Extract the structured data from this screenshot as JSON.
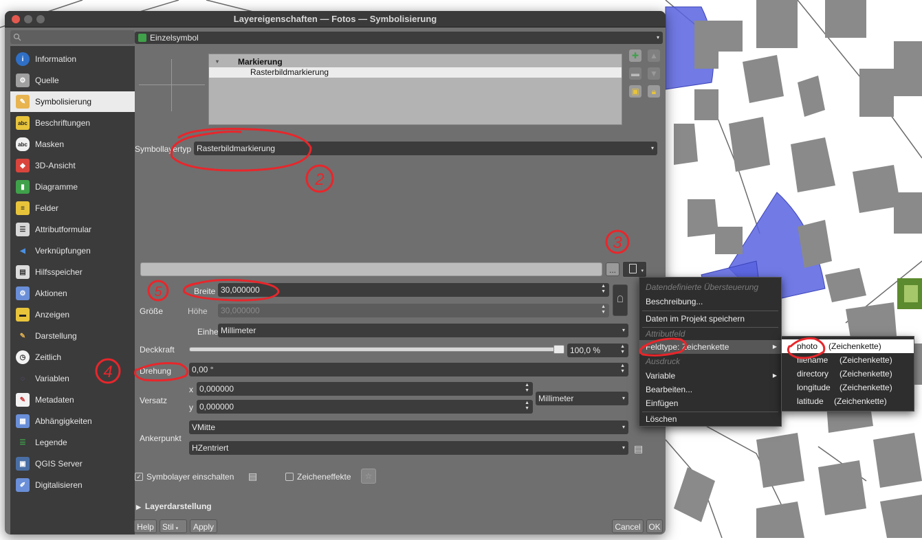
{
  "window": {
    "title": "Layereigenschaften — Fotos — Symbolisierung"
  },
  "search": {
    "placeholder": ""
  },
  "sidebar": {
    "items": [
      {
        "label": "Information",
        "icon": "info-icon",
        "active": false
      },
      {
        "label": "Quelle",
        "icon": "source-icon",
        "active": false
      },
      {
        "label": "Symbolisierung",
        "icon": "paintbrush-icon",
        "active": true
      },
      {
        "label": "Beschriftungen",
        "icon": "labels-abc-icon",
        "active": false
      },
      {
        "label": "Masken",
        "icon": "masks-abc-icon",
        "active": false
      },
      {
        "label": "3D-Ansicht",
        "icon": "cube-3d-icon",
        "active": false
      },
      {
        "label": "Diagramme",
        "icon": "diagram-icon",
        "active": false
      },
      {
        "label": "Felder",
        "icon": "fields-icon",
        "active": false
      },
      {
        "label": "Attributformular",
        "icon": "form-icon",
        "active": false
      },
      {
        "label": "Verknüpfungen",
        "icon": "join-icon",
        "active": false
      },
      {
        "label": "Hilfsspeicher",
        "icon": "storage-icon",
        "active": false
      },
      {
        "label": "Aktionen",
        "icon": "gear-icon",
        "active": false
      },
      {
        "label": "Anzeigen",
        "icon": "speech-bubble-icon",
        "active": false
      },
      {
        "label": "Darstellung",
        "icon": "brush-icon",
        "active": false
      },
      {
        "label": "Zeitlich",
        "icon": "clock-icon",
        "active": false
      },
      {
        "label": "Variablen",
        "icon": "variables-icon",
        "active": false
      },
      {
        "label": "Metadaten",
        "icon": "metadata-icon",
        "active": false
      },
      {
        "label": "Abhängigkeiten",
        "icon": "dependencies-icon",
        "active": false
      },
      {
        "label": "Legende",
        "icon": "legend-icon",
        "active": false
      },
      {
        "label": "QGIS Server",
        "icon": "server-icon",
        "active": false
      },
      {
        "label": "Digitalisieren",
        "icon": "digitize-icon",
        "active": false
      }
    ]
  },
  "renderer": {
    "type": "Einzelsymbol"
  },
  "layer_tree": {
    "parent": "Markierung",
    "child": "Rasterbildmarkierung"
  },
  "symbol_layer_type": {
    "label": "Symbollayertyp",
    "value": "Rasterbildmarkierung"
  },
  "file": {
    "path": "",
    "browse_label": "..."
  },
  "size": {
    "group_label": "Größe",
    "width_label": "Breite",
    "width_value": "30,000000",
    "height_label": "Höhe",
    "height_value": "30,000000",
    "unit_label": "Einheit",
    "unit_value": "Millimeter"
  },
  "opacity": {
    "label": "Deckkraft",
    "value": "100,0 %",
    "level": 1.0
  },
  "rotation": {
    "label": "Drehung",
    "value": "0,00 °"
  },
  "offset": {
    "label": "Versatz",
    "x_label": "x",
    "x_value": "0,000000",
    "y_label": "y",
    "y_value": "0,000000",
    "unit_value": "Millimeter"
  },
  "anchor": {
    "label": "Ankerpunkt",
    "vertical": "VMitte",
    "horizontal": "HZentriert"
  },
  "options": {
    "enable_label": "Symbolayer einschalten",
    "enabled": true,
    "effects_label": "Zeicheneffekte",
    "effects": false
  },
  "layer_render": {
    "label": "Layerdarstellung"
  },
  "footer": {
    "help": "Help",
    "style": "Stil",
    "apply": "Apply",
    "cancel": "Cancel",
    "ok": "OK"
  },
  "context_menu": {
    "header": "Datendefinierte Übersteuerung",
    "description": "Beschreibung...",
    "store": "Daten im Projekt speichern",
    "attribute_field": "Attributfeld",
    "field_type": "Feldtype: Zeichenkette",
    "expression": "Ausdruck",
    "variable": "Variable",
    "edit": "Bearbeiten...",
    "paste": "Einfügen",
    "delete": "Löschen"
  },
  "field_submenu": [
    {
      "name": "photo",
      "type": "(Zeichenkette)"
    },
    {
      "name": "filename",
      "type": "(Zeichenkette)"
    },
    {
      "name": "directory",
      "type": "(Zeichenkette)"
    },
    {
      "name": "longitude",
      "type": "(Zeichenkette)"
    },
    {
      "name": "latitude",
      "type": "(Zeichenkette)"
    }
  ],
  "annotations": [
    "2",
    "3",
    "4",
    "5"
  ],
  "colors": {
    "annotation": "#e8262b",
    "map_building": "#8a8a8a",
    "photo_cone": "#5863e0"
  }
}
